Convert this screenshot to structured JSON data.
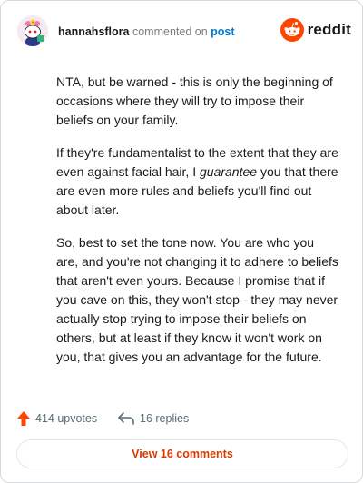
{
  "header": {
    "username": "hannahsflora",
    "verb": "commented on",
    "post_link": "post",
    "brand": "reddit",
    "brand_color": "#ff4500",
    "avatar_icon": "snoo-avatar-icon"
  },
  "comment": {
    "paragraph_1": "NTA, but be warned - this is only the beginning of occasions where they will try to impose their beliefs on your family.",
    "paragraph_2_before": "If they're fundamentalist to the extent that they are even against facial hair, I ",
    "paragraph_2_emphasis": "guarantee",
    "paragraph_2_after": " you that there are even more rules and beliefs you'll find out about later.",
    "paragraph_3": "So, best to set the tone now. You are who you are, and you're not changing it to adhere to beliefs that aren't even yours. Because I promise that if you cave on this, they won't stop - they may never actually stop trying to impose their beliefs on others, but at least if they know it won't work on you, that gives you an advantage for the future."
  },
  "stats": {
    "upvotes": "414 upvotes",
    "replies": "16 replies",
    "upvote_color": "#ff4500",
    "upvote_icon": "upvote-arrow-icon",
    "reply_icon": "reply-arrow-icon"
  },
  "actions": {
    "view_comments": "View 16 comments",
    "accent_color": "#d93a00"
  }
}
